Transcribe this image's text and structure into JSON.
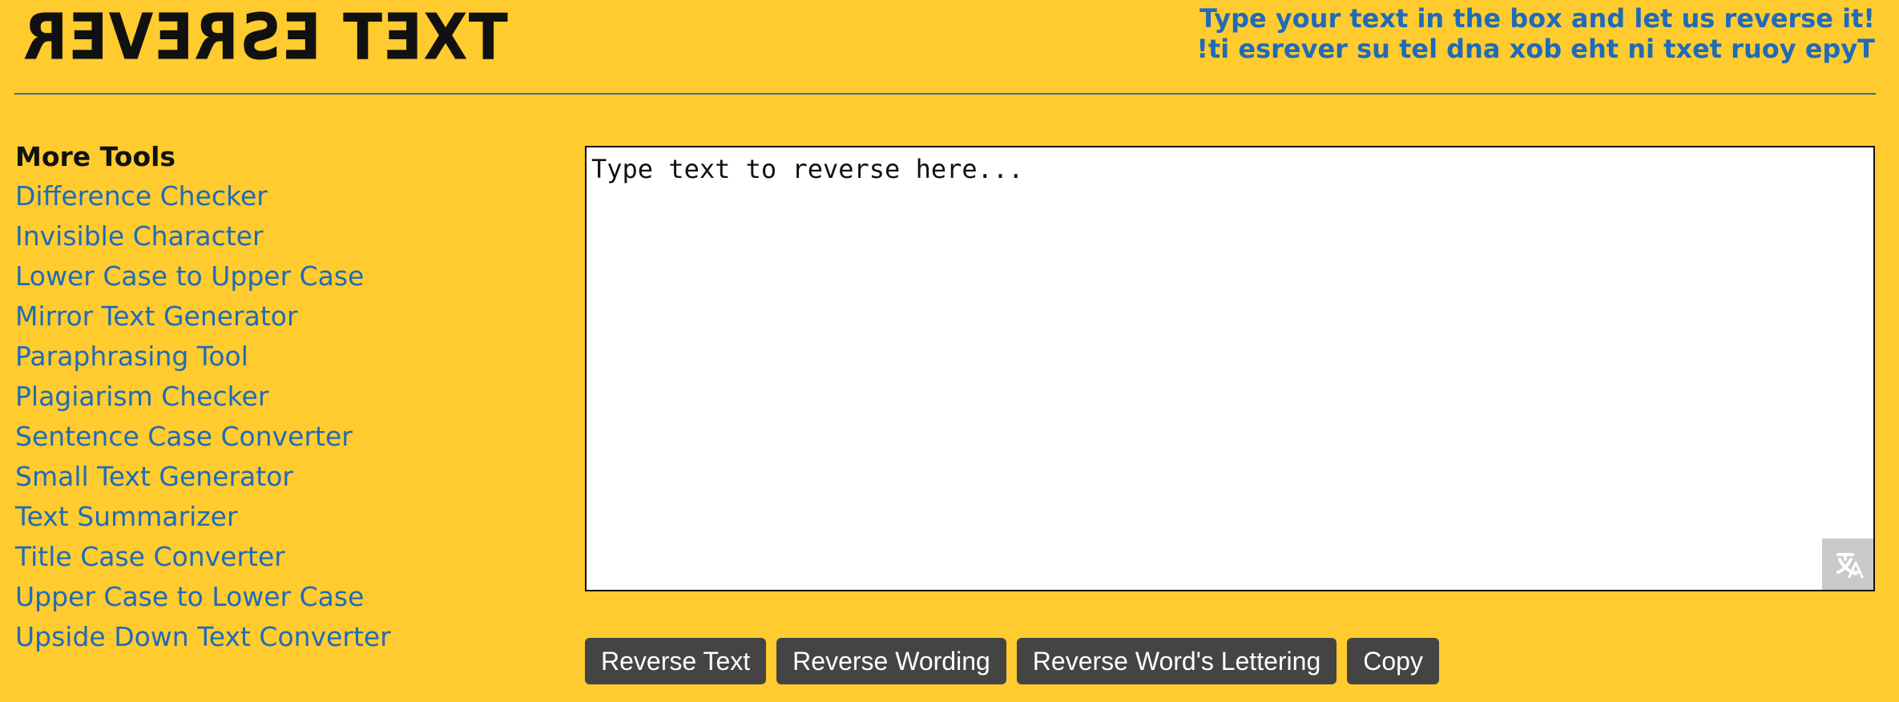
{
  "header": {
    "logo_text": "TEXT REVERSE",
    "tagline_line1": "Type your text in the box and let us reverse it!",
    "tagline_line2": "!ti esrever su tel dna xob eht ni txet ruoy epyT"
  },
  "sidebar": {
    "title": "More Tools",
    "items": [
      {
        "label": "Difference Checker"
      },
      {
        "label": "Invisible Character"
      },
      {
        "label": "Lower Case to Upper Case"
      },
      {
        "label": "Mirror Text Generator"
      },
      {
        "label": "Paraphrasing Tool"
      },
      {
        "label": "Plagiarism Checker"
      },
      {
        "label": "Sentence Case Converter"
      },
      {
        "label": "Small Text Generator"
      },
      {
        "label": "Text Summarizer"
      },
      {
        "label": "Title Case Converter"
      },
      {
        "label": "Upper Case to Lower Case"
      },
      {
        "label": "Upside Down Text Converter"
      }
    ]
  },
  "editor": {
    "placeholder": "Type text to reverse here...",
    "value": ""
  },
  "buttons": {
    "reverse_text": "Reverse Text",
    "reverse_wording": "Reverse Wording",
    "reverse_word_lettering": "Reverse Word's Lettering",
    "copy": "Copy"
  },
  "colors": {
    "background": "#FFCB2F",
    "link": "#1F6BB9",
    "button": "#444444"
  },
  "icons": {
    "translate": "translate-icon"
  }
}
